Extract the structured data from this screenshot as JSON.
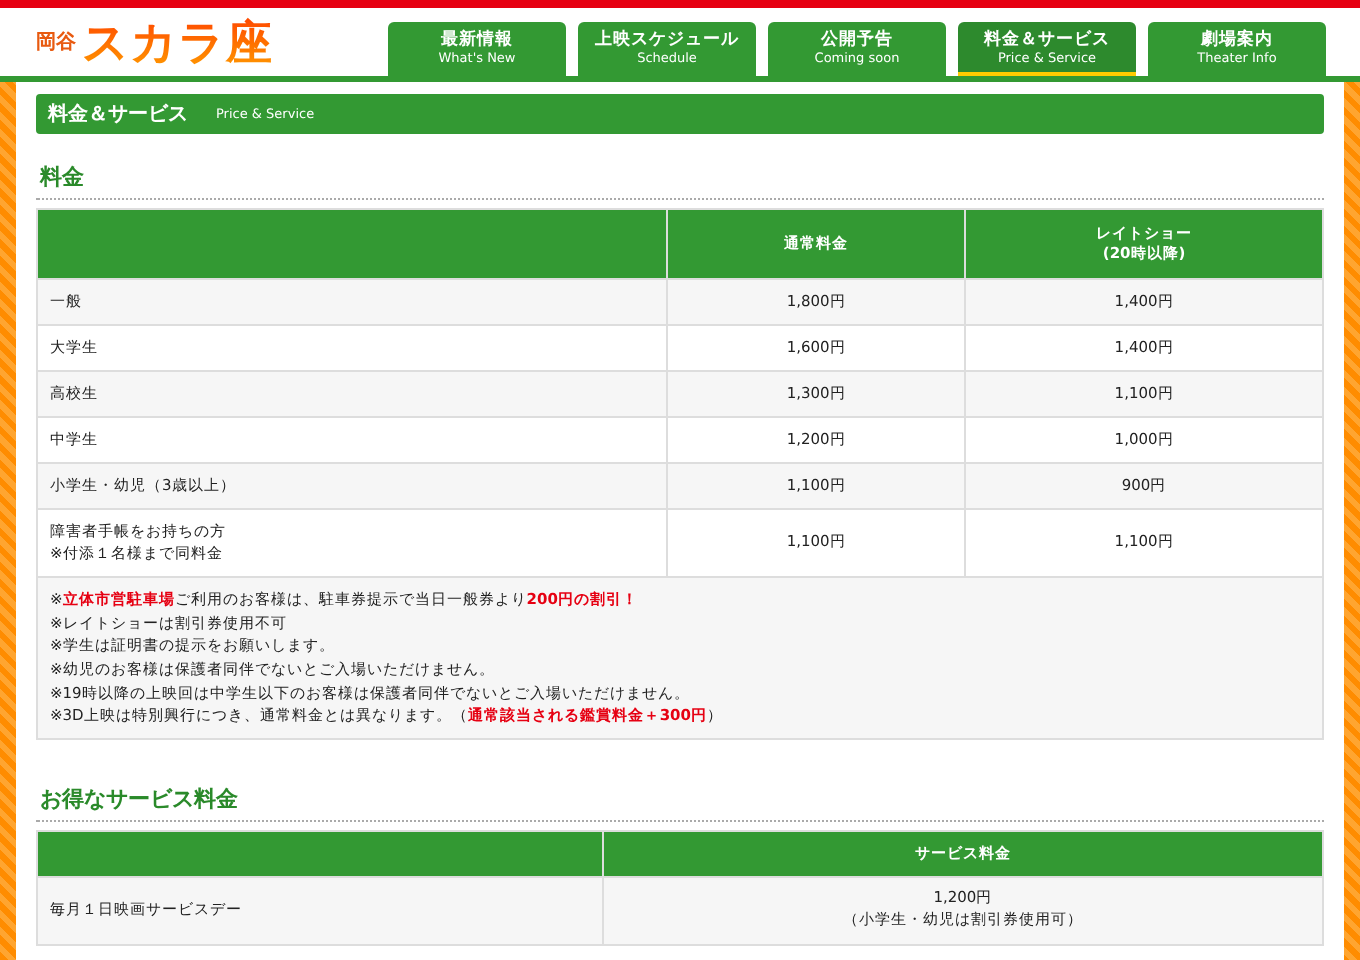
{
  "logo": {
    "small": "岡谷",
    "large": "スカラ座"
  },
  "nav": [
    {
      "label": "最新情報",
      "sub": "What's New",
      "selected": false
    },
    {
      "label": "上映スケジュール",
      "sub": "Schedule",
      "selected": false
    },
    {
      "label": "公開予告",
      "sub": "Coming soon",
      "selected": false
    },
    {
      "label": "料金＆サービス",
      "sub": "Price & Service",
      "selected": true
    },
    {
      "label": "劇場案内",
      "sub": "Theater Info",
      "selected": false
    }
  ],
  "page_title": {
    "title": "料金＆サービス",
    "subtitle": "Price & Service"
  },
  "price_section": {
    "heading": "料金",
    "columns": [
      "通常料金",
      "レイトショー\n(20時以降)"
    ],
    "rows": [
      {
        "label": "一般",
        "values": [
          "1,800円",
          "1,400円"
        ]
      },
      {
        "label": "大学生",
        "values": [
          "1,600円",
          "1,400円"
        ]
      },
      {
        "label": "高校生",
        "values": [
          "1,300円",
          "1,100円"
        ]
      },
      {
        "label": "中学生",
        "values": [
          "1,200円",
          "1,000円"
        ]
      },
      {
        "label": "小学生・幼児（3歳以上）",
        "values": [
          "1,100円",
          "900円"
        ]
      },
      {
        "label": "障害者手帳をお持ちの方",
        "label_note": "※付添１名様まで同料金",
        "values": [
          "1,100円",
          "1,100円"
        ]
      }
    ],
    "notes": [
      [
        {
          "text": "※",
          "highlight": false
        },
        {
          "text": "立体市営駐車場",
          "highlight": true
        },
        {
          "text": "ご利用のお客様は、駐車券提示で当日一般券より",
          "highlight": false
        },
        {
          "text": "200円の割引！",
          "highlight": true
        }
      ],
      [
        {
          "text": "※レイトショーは割引券使用不可",
          "highlight": false
        }
      ],
      [
        {
          "text": "※学生は証明書の提示をお願いします。",
          "highlight": false
        }
      ],
      [
        {
          "text": "※幼児のお客様は保護者同伴でないとご入場いただけません。",
          "highlight": false
        }
      ],
      [
        {
          "text": "※19時以降の上映回は中学生以下のお客様は保護者同伴でないとご入場いただけません。",
          "highlight": false
        }
      ],
      [
        {
          "text": "※3D上映は特別興行につき、通常料金とは異なります。（",
          "highlight": false
        },
        {
          "text": "通常該当される鑑賞料金＋300円",
          "highlight": true
        },
        {
          "text": "）",
          "highlight": false
        }
      ]
    ]
  },
  "service_section": {
    "heading": "お得なサービス料金",
    "columns": [
      "サービス料金"
    ],
    "rows": [
      {
        "label": "毎月１日映画サービスデー",
        "values": [
          "1,200円"
        ],
        "value_note": "（小学生・幼児は割引券使用可）"
      }
    ]
  }
}
